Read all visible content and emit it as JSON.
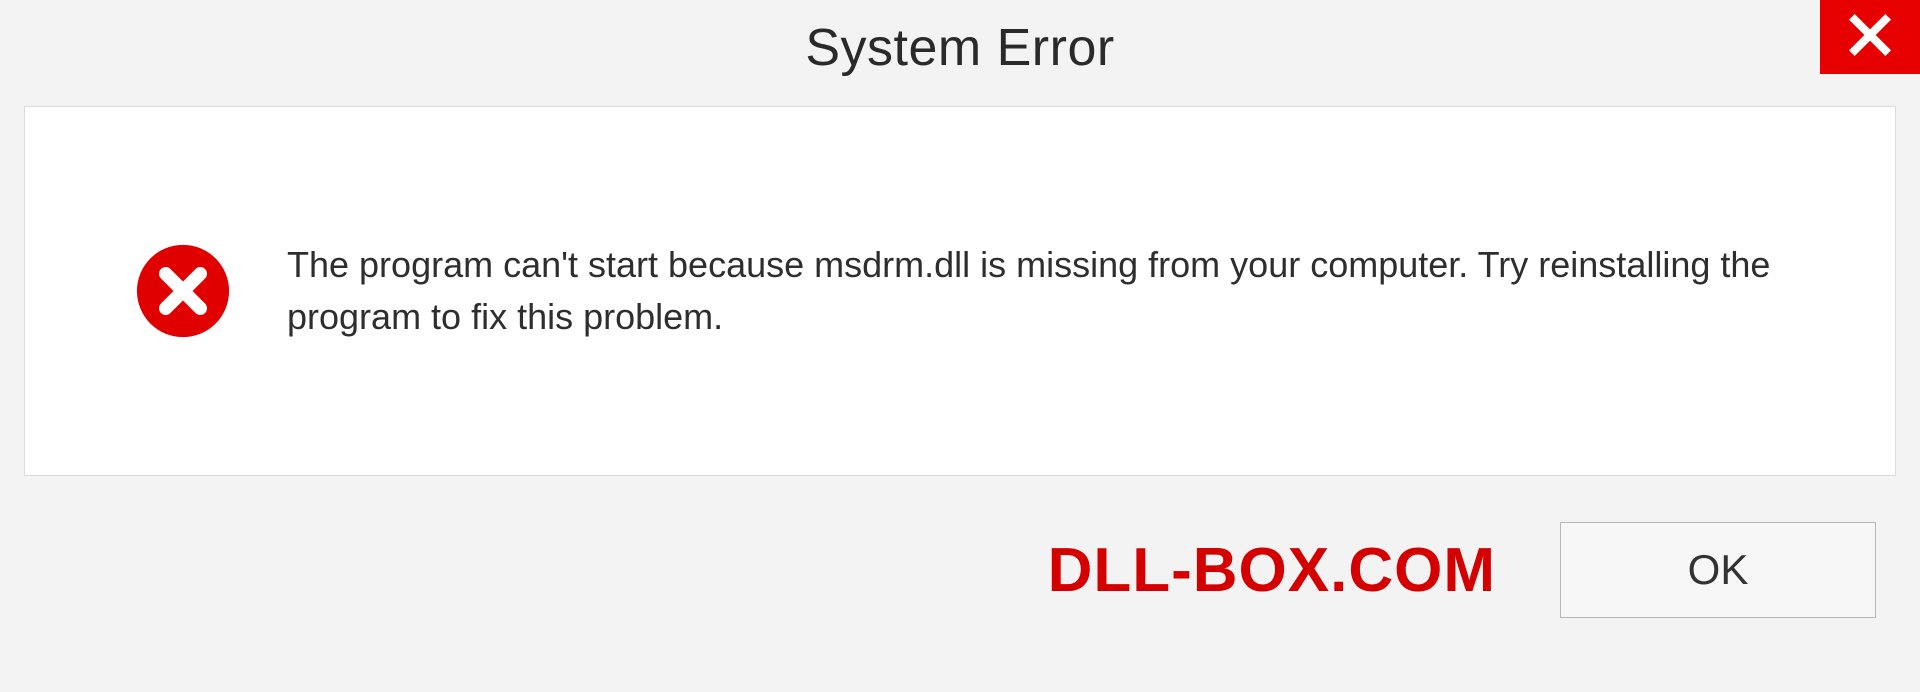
{
  "dialog": {
    "title": "System Error",
    "message": "The program can't start because msdrm.dll is missing from your computer. Try reinstalling the program to fix this problem.",
    "ok_label": "OK"
  },
  "watermark": "DLL-BOX.COM"
}
